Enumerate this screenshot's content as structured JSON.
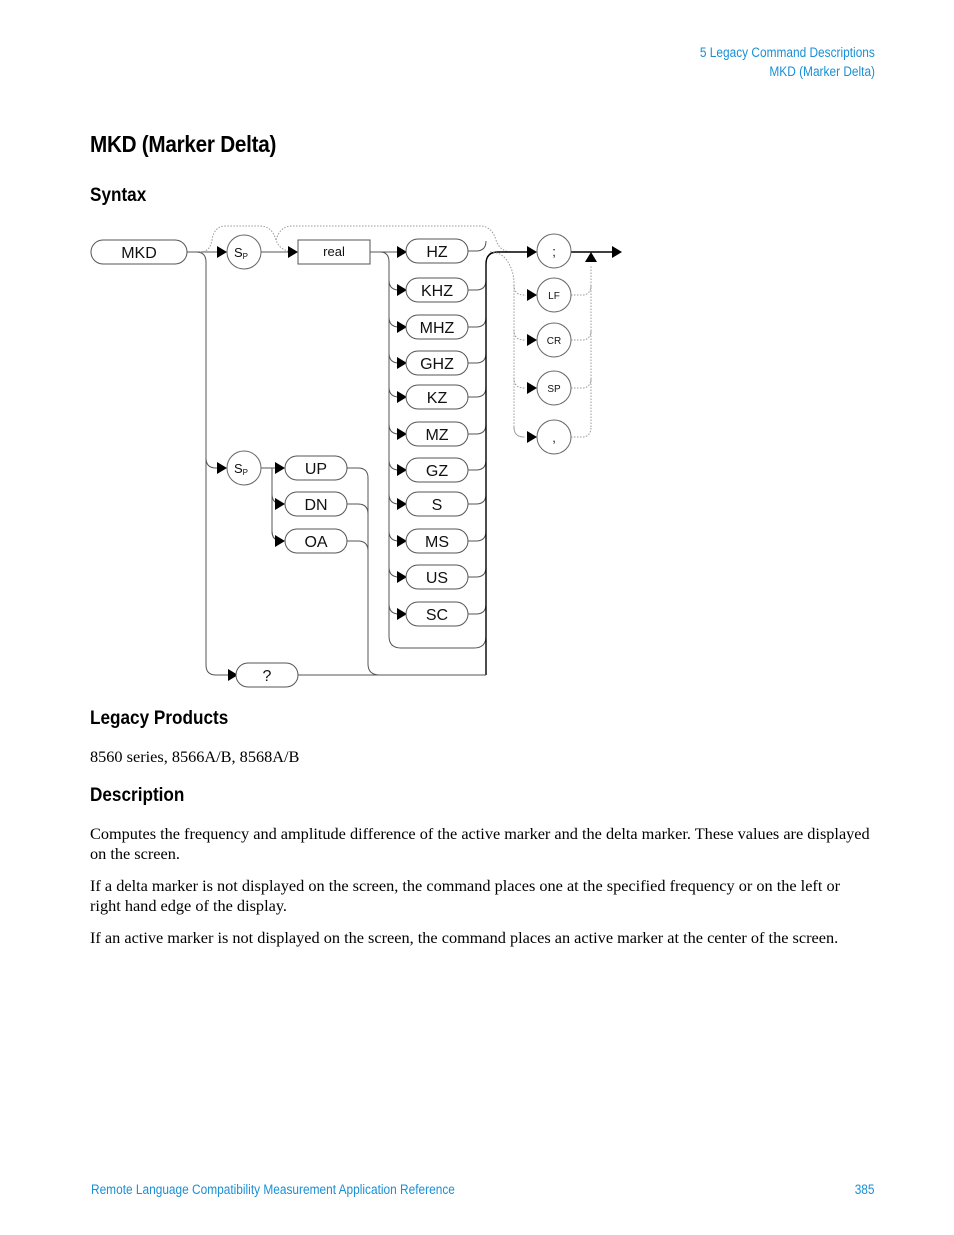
{
  "header": {
    "chapter": "5  Legacy Command Descriptions",
    "section": "MKD (Marker Delta)"
  },
  "title": "MKD (Marker Delta)",
  "syntax": {
    "heading": "Syntax",
    "diagram": {
      "command": "MKD",
      "sp_token": "S",
      "sp_sub": "P",
      "real_token": "real",
      "units": [
        "HZ",
        "KHZ",
        "MHZ",
        "GHZ",
        "KZ",
        "MZ",
        "GZ",
        "S",
        "MS",
        "US",
        "SC"
      ],
      "options": [
        "UP",
        "DN",
        "OA"
      ],
      "query": "?",
      "terminators": [
        ";",
        "LF",
        "CR",
        "SP",
        ","
      ]
    }
  },
  "legacy_products": {
    "heading": "Legacy Products",
    "text": "8560 series, 8566A/B, 8568A/B"
  },
  "description": {
    "heading": "Description",
    "paragraphs": [
      "Computes the frequency and amplitude difference of the active marker and the delta marker. These values are displayed on the screen.",
      "If a delta marker is not displayed on the screen, the command places one at the specified frequency or on the left or right hand edge of the display.",
      "If an active marker is not displayed on the screen, the command places an active marker at the center of the screen."
    ]
  },
  "footer": {
    "title": "Remote Language Compatibility Measurement Application Reference",
    "page": "385"
  }
}
